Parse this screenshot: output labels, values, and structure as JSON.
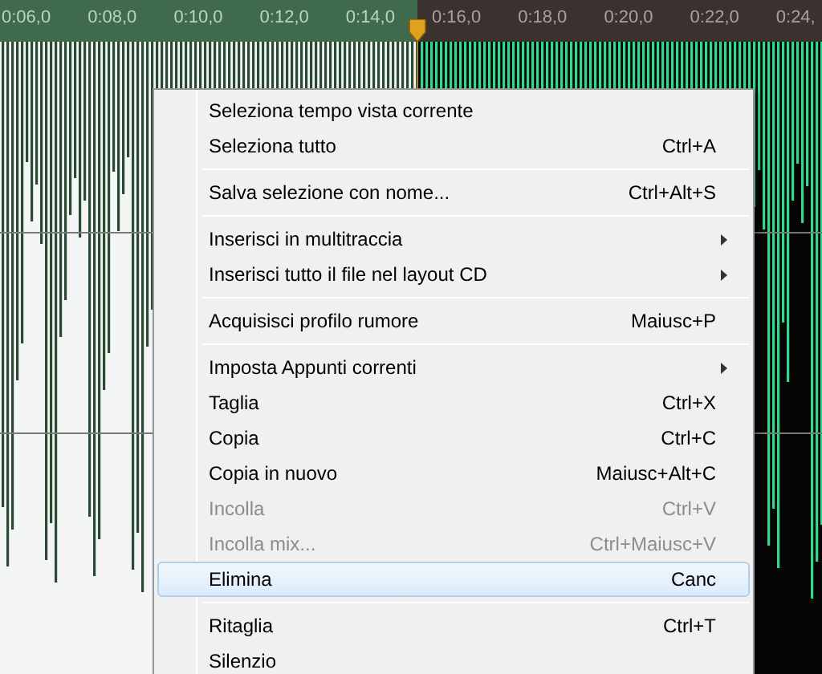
{
  "ruler": {
    "labels": [
      "0:06,0",
      "0:08,0",
      "0:10,0",
      "0:12,0",
      "0:14,0",
      "0:16,0",
      "0:18,0",
      "0:20,0",
      "0:22,0",
      "0:24,"
    ]
  },
  "context_menu": {
    "items": [
      {
        "kind": "item",
        "label": "Seleziona tempo vista corrente",
        "submenu": false,
        "disabled": false,
        "selected": false
      },
      {
        "kind": "item",
        "label": "Seleziona tutto",
        "shortcut": "Ctrl+A",
        "submenu": false,
        "disabled": false,
        "selected": false
      },
      {
        "kind": "separator"
      },
      {
        "kind": "item",
        "label": "Salva selezione con nome...",
        "shortcut": "Ctrl+Alt+S",
        "submenu": false,
        "disabled": false,
        "selected": false
      },
      {
        "kind": "separator"
      },
      {
        "kind": "item",
        "label": "Inserisci in multitraccia",
        "submenu": true,
        "disabled": false,
        "selected": false
      },
      {
        "kind": "item",
        "label": "Inserisci tutto il file nel layout CD",
        "submenu": true,
        "disabled": false,
        "selected": false
      },
      {
        "kind": "separator"
      },
      {
        "kind": "item",
        "label": "Acquisisci profilo rumore",
        "shortcut": "Maiusc+P",
        "submenu": false,
        "disabled": false,
        "selected": false
      },
      {
        "kind": "separator"
      },
      {
        "kind": "item",
        "label": "Imposta Appunti correnti",
        "submenu": true,
        "disabled": false,
        "selected": false
      },
      {
        "kind": "item",
        "label": "Taglia",
        "shortcut": "Ctrl+X",
        "submenu": false,
        "disabled": false,
        "selected": false
      },
      {
        "kind": "item",
        "label": "Copia",
        "shortcut": "Ctrl+C",
        "submenu": false,
        "disabled": false,
        "selected": false
      },
      {
        "kind": "item",
        "label": "Copia in nuovo",
        "shortcut": "Maiusc+Alt+C",
        "submenu": false,
        "disabled": false,
        "selected": false
      },
      {
        "kind": "item",
        "label": "Incolla",
        "shortcut": "Ctrl+V",
        "submenu": false,
        "disabled": true,
        "selected": false
      },
      {
        "kind": "item",
        "label": "Incolla mix...",
        "shortcut": "Ctrl+Maiusc+V",
        "submenu": false,
        "disabled": true,
        "selected": false
      },
      {
        "kind": "item",
        "label": "Elimina",
        "shortcut": "Canc",
        "submenu": false,
        "disabled": false,
        "selected": true
      },
      {
        "kind": "separator"
      },
      {
        "kind": "item",
        "label": "Ritaglia",
        "shortcut": "Ctrl+T",
        "submenu": false,
        "disabled": false,
        "selected": false
      },
      {
        "kind": "item",
        "label": "Silenzio",
        "submenu": false,
        "disabled": false,
        "selected": false
      }
    ]
  }
}
